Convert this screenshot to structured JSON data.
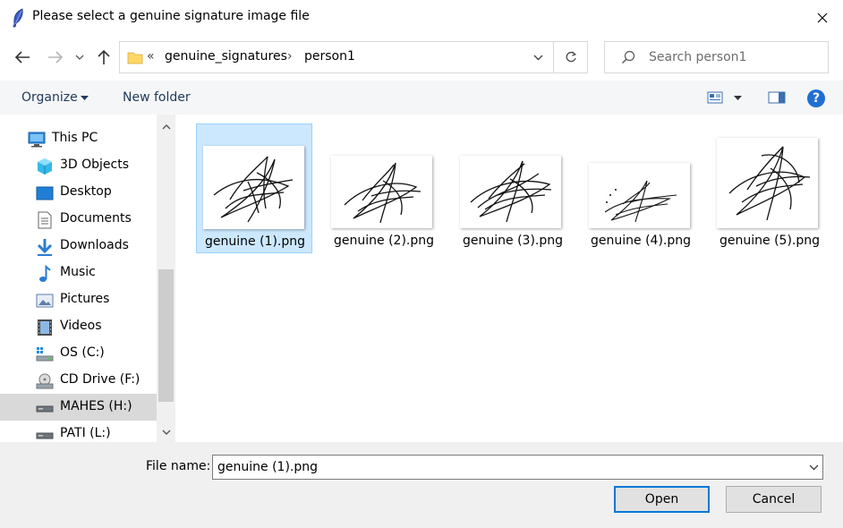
{
  "window": {
    "title": "Please select a genuine signature image file",
    "close_label": "Close"
  },
  "navigation": {
    "breadcrumb": {
      "overflow": "«",
      "segments": [
        "genuine_signatures",
        "person1"
      ],
      "separator": "›"
    },
    "search": {
      "placeholder": "Search person1"
    }
  },
  "toolbar": {
    "organize_label": "Organize",
    "new_folder_label": "New folder",
    "help_label": "?"
  },
  "sidebar": {
    "items": [
      {
        "label": "This PC",
        "icon": "computer-icon"
      },
      {
        "label": "3D Objects",
        "icon": "3d-objects-icon"
      },
      {
        "label": "Desktop",
        "icon": "desktop-icon"
      },
      {
        "label": "Documents",
        "icon": "documents-icon"
      },
      {
        "label": "Downloads",
        "icon": "downloads-icon"
      },
      {
        "label": "Music",
        "icon": "music-icon"
      },
      {
        "label": "Pictures",
        "icon": "pictures-icon"
      },
      {
        "label": "Videos",
        "icon": "videos-icon"
      },
      {
        "label": "OS (C:)",
        "icon": "os-drive-icon"
      },
      {
        "label": "CD Drive (F:)",
        "icon": "cd-drive-icon"
      },
      {
        "label": "MAHES (H:)",
        "icon": "usb-drive-icon",
        "selected": true
      },
      {
        "label": "PATI (L:)",
        "icon": "usb-drive-icon"
      }
    ]
  },
  "files": [
    {
      "name": "genuine (1).png",
      "selected": true
    },
    {
      "name": "genuine (2).png"
    },
    {
      "name": "genuine (3).png"
    },
    {
      "name": "genuine (4).png"
    },
    {
      "name": "genuine (5).png"
    }
  ],
  "footer": {
    "file_name_label": "File name:",
    "file_name_value": "genuine (1).png",
    "open_label": "Open",
    "cancel_label": "Cancel"
  },
  "colors": {
    "accent": "#0078d7",
    "selection": "#cce8ff",
    "selection_border": "#99d1ff",
    "link": "#1e395b",
    "help": "#1f6fd3"
  }
}
